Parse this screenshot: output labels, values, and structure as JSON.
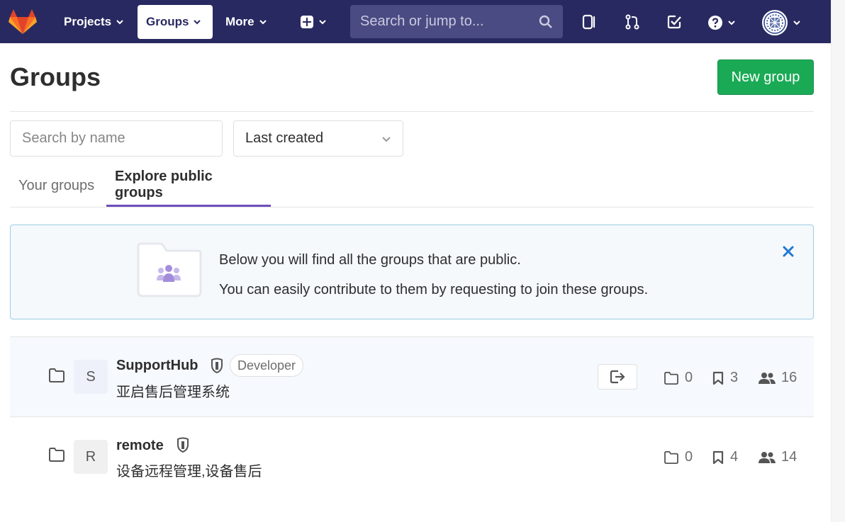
{
  "nav": {
    "projects": "Projects",
    "groups": "Groups",
    "more": "More",
    "search_placeholder": "Search or jump to..."
  },
  "page": {
    "title": "Groups",
    "new_group_label": "New group"
  },
  "filters": {
    "search_placeholder": "Search by name",
    "sort_selected": "Last created"
  },
  "tabs": [
    {
      "label": "Your groups",
      "active": false
    },
    {
      "label": "Explore public groups",
      "active": true
    }
  ],
  "alert": {
    "line1": "Below you will find all the groups that are public.",
    "line2": "You can easily contribute to them by requesting to join these groups."
  },
  "groups": [
    {
      "initial": "S",
      "name": "SupportHub",
      "role": "Developer",
      "description": "亚启售后管理系统",
      "subgroups": "0",
      "projects": "3",
      "members": "16"
    },
    {
      "initial": "R",
      "name": "remote",
      "role": "",
      "description": "设备远程管理,设备售后",
      "subgroups": "0",
      "projects": "4",
      "members": "14"
    }
  ],
  "colors": {
    "navbar": "#292961",
    "primary_button": "#1aaa55",
    "active_tab_border": "#6b4fbb",
    "alert_border": "#9bcbe4"
  }
}
